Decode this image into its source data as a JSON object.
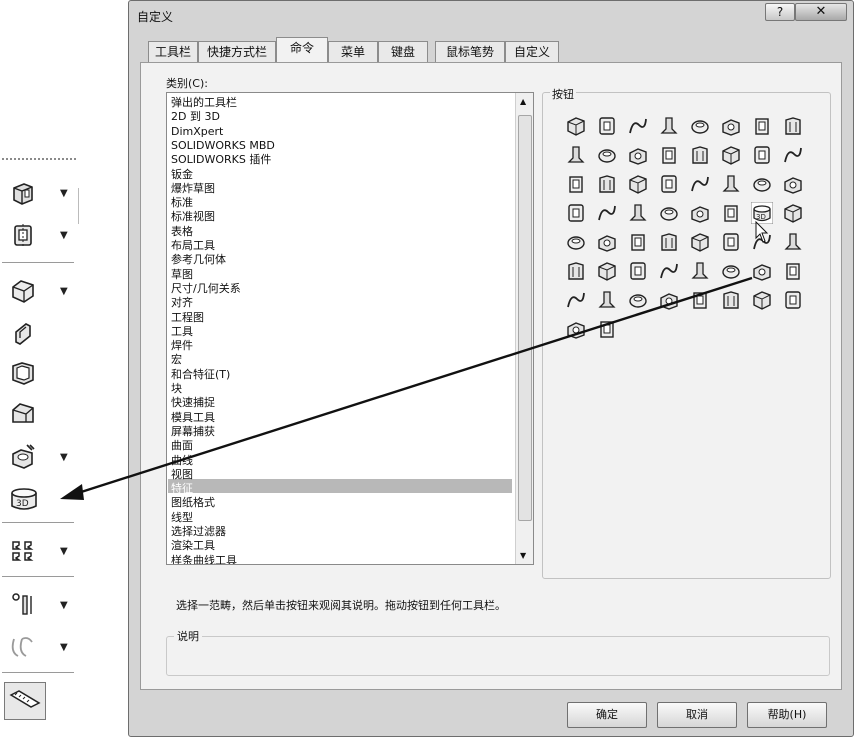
{
  "dialog": {
    "title": "自定义",
    "help_label": "?",
    "close_label": "✕",
    "tabs": [
      "工具栏",
      "快捷方式栏",
      "命令",
      "菜单",
      "键盘",
      "鼠标笔势",
      "自定义"
    ],
    "active_tab": "命令",
    "category_label": "类别(C):",
    "categories": [
      "弹出的工具栏",
      "2D 到 3D",
      "DimXpert",
      "SOLIDWORKS MBD",
      "SOLIDWORKS 插件",
      "钣金",
      "爆炸草图",
      "标准",
      "标准视图",
      "表格",
      "布局工具",
      "参考几何体",
      "草图",
      "尺寸/几何关系",
      "对齐",
      "工程图",
      "工具",
      "焊件",
      "宏",
      "和合特征(T)",
      "块",
      "快速捕捉",
      "模具工具",
      "屏幕捕获",
      "曲面",
      "曲线",
      "视图",
      "特征",
      "图纸格式",
      "线型",
      "选择过滤器",
      "渲染工具",
      "样条曲线工具"
    ],
    "selected_category": "特征",
    "buttons_label": "按钮",
    "instruction": "选择一范畴，然后单击按钮来观阅其说明。拖动按钮到任何工具栏。",
    "description_label": "说明",
    "ok_label": "确定",
    "cancel_label": "取消",
    "help_button_label": "帮助(H)"
  },
  "colors": {
    "dialog_bg": "#d4d4d4",
    "panel_bg": "#f2f2f2",
    "selection": "#b8b8b8"
  }
}
